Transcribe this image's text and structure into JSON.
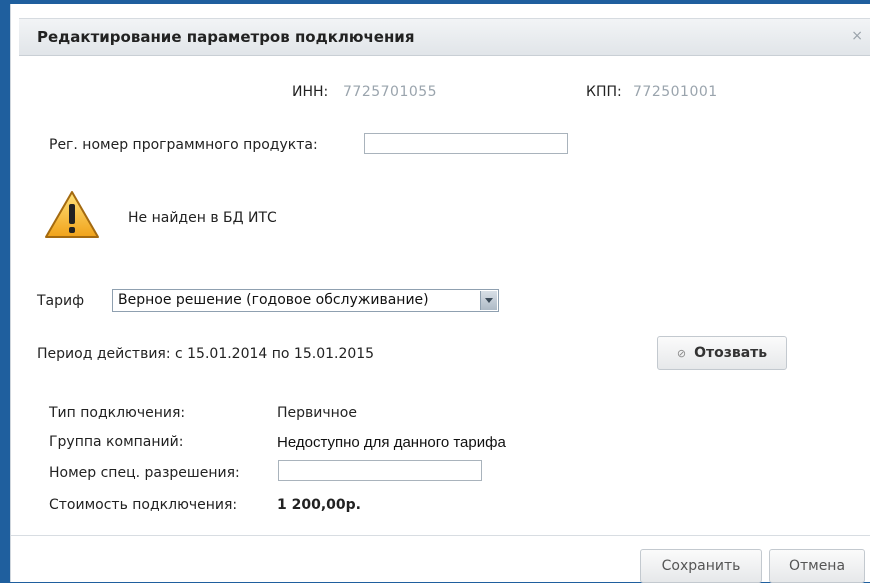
{
  "dialog": {
    "title": "Редактирование параметров подключения",
    "close_symbol": "×"
  },
  "ids": {
    "inn_label": "ИНН:",
    "inn_value": "7725701055",
    "kpp_label": "КПП:",
    "kpp_value": "772501001"
  },
  "reg": {
    "label": "Рег. номер программного продукта:",
    "value": ""
  },
  "warning": {
    "icon": "warning-icon",
    "text": "Не найден в БД ИТС"
  },
  "tariff": {
    "label": "Тариф",
    "selected": "Верное решение (годовое обслуживание)"
  },
  "period": {
    "text": "Период действия: с 15.01.2014 по 15.01.2015",
    "revoke_icon": "⊘",
    "revoke_label": "Отозвать"
  },
  "details": {
    "type_label": "Тип подключения:",
    "type_value": "Первичное",
    "group_label": "Группа компаний:",
    "group_value": "Недоступно для данного тарифа",
    "permit_label": "Номер спец. разрешения:",
    "permit_value": "",
    "cost_label": "Стоимость подключения:",
    "cost_value": "1 200,00р."
  },
  "footer": {
    "save_label": "Сохранить",
    "cancel_label": "Отмена"
  }
}
